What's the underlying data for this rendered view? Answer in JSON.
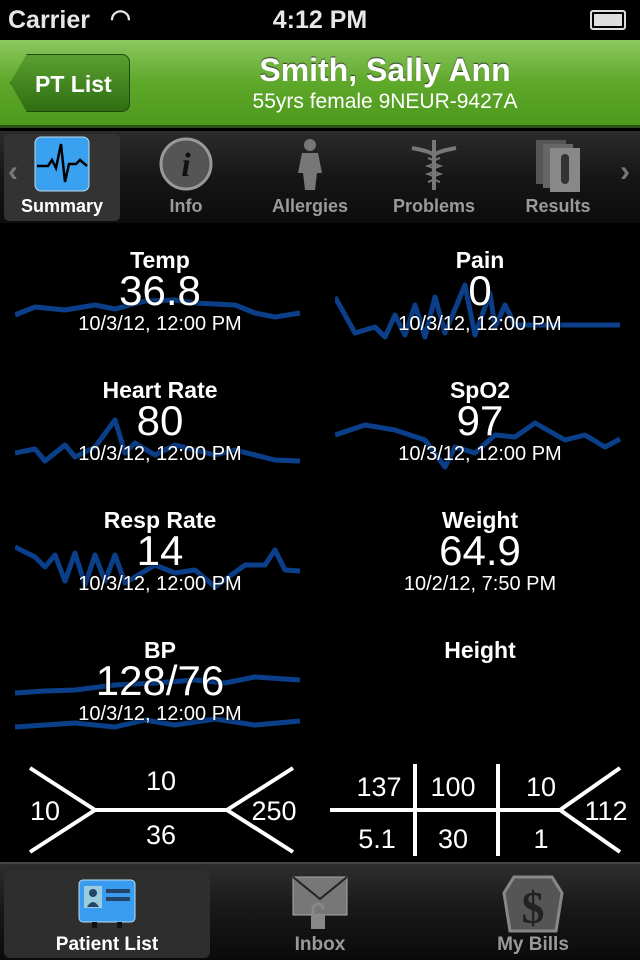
{
  "status": {
    "carrier": "Carrier",
    "time": "4:12 PM"
  },
  "header": {
    "back_label": "PT List",
    "patient_name": "Smith, Sally Ann",
    "patient_info": "55yrs female 9NEUR-9427A"
  },
  "tabs": [
    {
      "label": "Summary",
      "icon": "vitals-monitor-icon",
      "selected": true
    },
    {
      "label": "Info",
      "icon": "info-icon"
    },
    {
      "label": "Allergies",
      "icon": "person-icon"
    },
    {
      "label": "Problems",
      "icon": "caduceus-icon"
    },
    {
      "label": "Results",
      "icon": "test-tube-icon"
    }
  ],
  "vitals": [
    {
      "label": "Temp",
      "value": "36.8",
      "date": "10/3/12, 12:00 PM"
    },
    {
      "label": "Pain",
      "value": "0",
      "date": "10/3/12, 12:00 PM"
    },
    {
      "label": "Heart Rate",
      "value": "80",
      "date": "10/3/12, 12:00 PM"
    },
    {
      "label": "SpO2",
      "value": "97",
      "date": "10/3/12, 12:00 PM"
    },
    {
      "label": "Resp Rate",
      "value": "14",
      "date": "10/3/12, 12:00 PM"
    },
    {
      "label": "Weight",
      "value": "64.9",
      "date": "10/2/12, 7:50 PM"
    },
    {
      "label": "BP",
      "value": "128/76",
      "date": "10/3/12, 12:00 PM"
    },
    {
      "label": "Height",
      "value": "",
      "date": ""
    }
  ],
  "sparkline_color": "#0b3f8a",
  "cbc": {
    "wbc": "10",
    "hgb": "10",
    "hct": "36",
    "plt": "250"
  },
  "bmp": {
    "na": "137",
    "cl": "100",
    "bun": "10",
    "glucose": "112",
    "k": "5.1",
    "co2": "30",
    "cr": "1"
  },
  "bottom_tabs": [
    {
      "label": "Patient List",
      "icon": "patient-card-icon",
      "selected": true
    },
    {
      "label": "Inbox",
      "icon": "locked-envelope-icon"
    },
    {
      "label": "My Bills",
      "icon": "dollar-shield-icon"
    }
  ]
}
